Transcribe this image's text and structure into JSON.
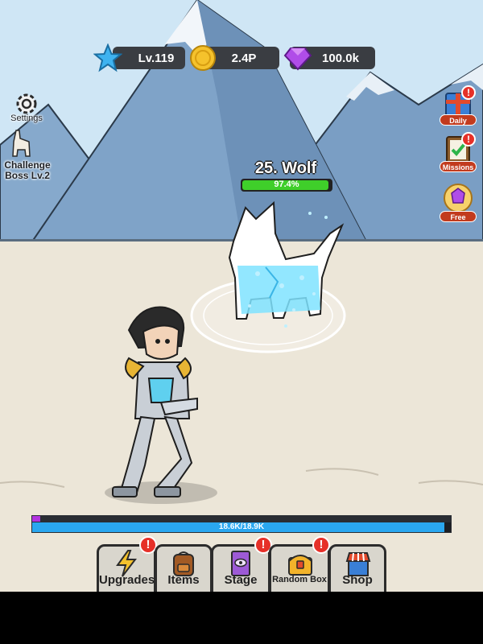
{
  "hud": {
    "level": "Lv.119",
    "gold": "2.4P",
    "gems": "100.0k"
  },
  "left_menu": {
    "settings_label": "Settings",
    "challenge_label_line1": "Challenge",
    "challenge_label_line2": "Boss Lv.2"
  },
  "right_menu": {
    "daily_label": "Daily",
    "missions_label": "Missions",
    "free_label": "Free",
    "badge_symbol": "!"
  },
  "enemy": {
    "name": "25. Wolf",
    "hp_percent_text": "97.4%",
    "hp_fraction": 0.974
  },
  "player": {
    "hp_text": "18.6K/18.9K",
    "hp_fraction": 0.984,
    "xp_fraction": 0.02
  },
  "tabs": [
    {
      "label": "Upgrades",
      "badge": "!"
    },
    {
      "label": "Items",
      "badge": ""
    },
    {
      "label": "Stage",
      "badge": "!"
    },
    {
      "label": "Random Box",
      "badge": "!"
    },
    {
      "label": "Shop",
      "badge": ""
    }
  ],
  "colors": {
    "sky": "#cfe6f5",
    "ground": "#ece6d8",
    "hp_green": "#3fcf2a",
    "hp_blue": "#2aa7f0",
    "xp_purple": "#b233e0",
    "badge_red": "#e63028"
  }
}
